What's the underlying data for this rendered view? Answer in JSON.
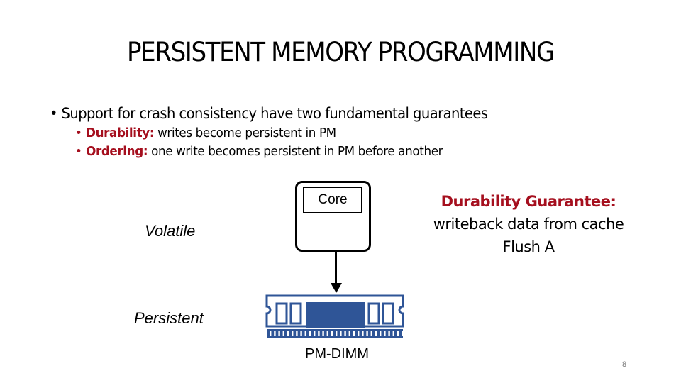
{
  "slide": {
    "title": "PERSISTENT MEMORY PROGRAMMING",
    "bullets": {
      "main": "Support for crash consistency have two fundamental guarantees",
      "sub": [
        {
          "term": "Durability:",
          "text": " writes become persistent in PM"
        },
        {
          "term": "Ordering:",
          "text": " one write becomes persistent in PM before another"
        }
      ]
    },
    "diagram": {
      "core_label": "Core",
      "volatile_label": "Volatile",
      "persistent_label": "Persistent",
      "dimm_label": "PM-DIMM",
      "dimm_color": "#2f5597",
      "accent_color": "#a50f1e"
    },
    "guarantee_box": {
      "heading": "Durability Guarantee:",
      "line1": "writeback data from cache",
      "line2": "Flush A"
    },
    "slide_number": "8"
  }
}
